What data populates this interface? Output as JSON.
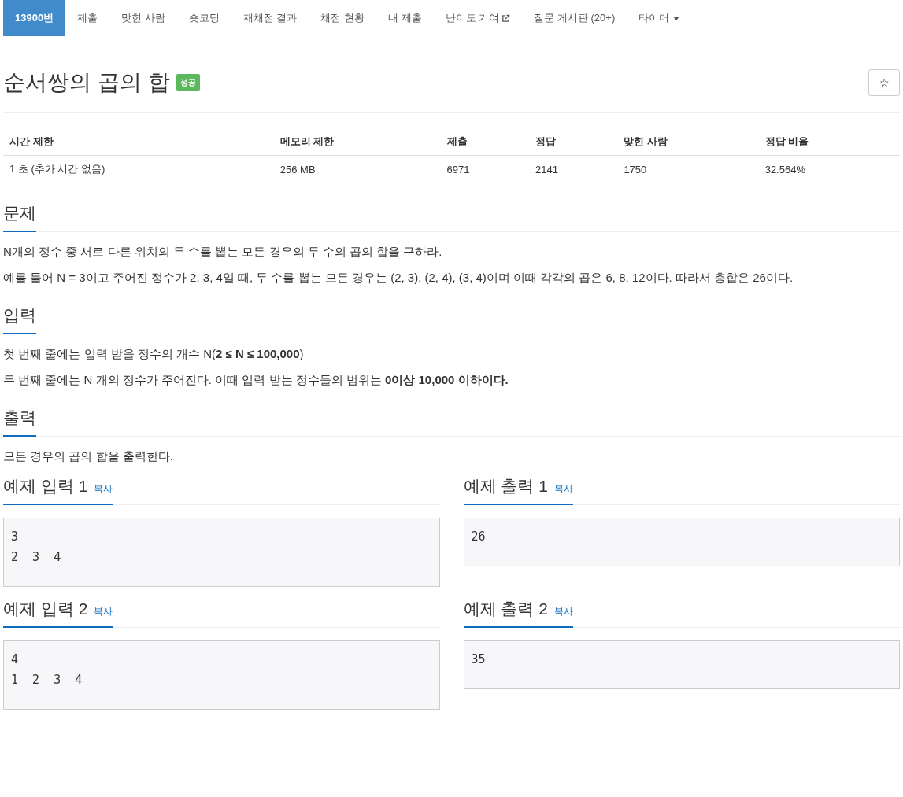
{
  "tabs": [
    {
      "label": "13900번",
      "selected": true,
      "kind": "plain"
    },
    {
      "label": "제출",
      "selected": false,
      "kind": "plain"
    },
    {
      "label": "맞힌 사람",
      "selected": false,
      "kind": "plain"
    },
    {
      "label": "숏코딩",
      "selected": false,
      "kind": "plain"
    },
    {
      "label": "재채점 결과",
      "selected": false,
      "kind": "plain"
    },
    {
      "label": "채점 현황",
      "selected": false,
      "kind": "plain"
    },
    {
      "label": "내 제출",
      "selected": false,
      "kind": "plain"
    },
    {
      "label": "난이도 기여",
      "selected": false,
      "kind": "external"
    },
    {
      "label": "질문 게시판 (20+)",
      "selected": false,
      "kind": "plain"
    },
    {
      "label": "타이머",
      "selected": false,
      "kind": "dropdown"
    }
  ],
  "title": "순서쌍의 곱의 합",
  "status_badge": "성공",
  "star_button": "☆",
  "stats": {
    "columns": [
      "시간 제한",
      "메모리 제한",
      "제출",
      "정답",
      "맞힌 사람",
      "정답 비율"
    ],
    "row": [
      "1 초 (추가 시간 없음)",
      "256 MB",
      "6971",
      "2141",
      "1750",
      "32.564%"
    ]
  },
  "sections": [
    {
      "heading": "문제",
      "paragraphs": [
        "N개의 정수 중 서로 다른 위치의 두 수를 뽑는 모든 경우의 두 수의 곱의 합을 구하라.",
        "예를 들어 N = 3이고 주어진 정수가 2, 3, 4일 때, 두 수를 뽑는 모든 경우는 (2, 3), (2, 4), (3, 4)이며 이때 각각의 곱은 6, 8, 12이다. 따라서 총합은 26이다."
      ]
    },
    {
      "heading": "입력",
      "paragraphs": [
        "첫 번째 줄에는 입력 받을 정수의 개수 N(**2 ≤ N ≤ 100,000**)",
        "두 번째 줄에는 N 개의 정수가 주어진다. 이때 입력 받는 정수들의 범위는 **0이상 10,000 이하이다.**"
      ]
    },
    {
      "heading": "출력",
      "paragraphs": [
        "모든 경우의 곱의 합을 출력한다."
      ]
    }
  ],
  "samples": [
    {
      "heading": "예제 입력 1",
      "copy": "복사",
      "content": "3\n2  3  4"
    },
    {
      "heading": "예제 출력 1",
      "copy": "복사",
      "content": "26"
    },
    {
      "heading": "예제 입력 2",
      "copy": "복사",
      "content": "4\n1  2  3  4"
    },
    {
      "heading": "예제 출력 2",
      "copy": "복사",
      "content": "35"
    }
  ]
}
